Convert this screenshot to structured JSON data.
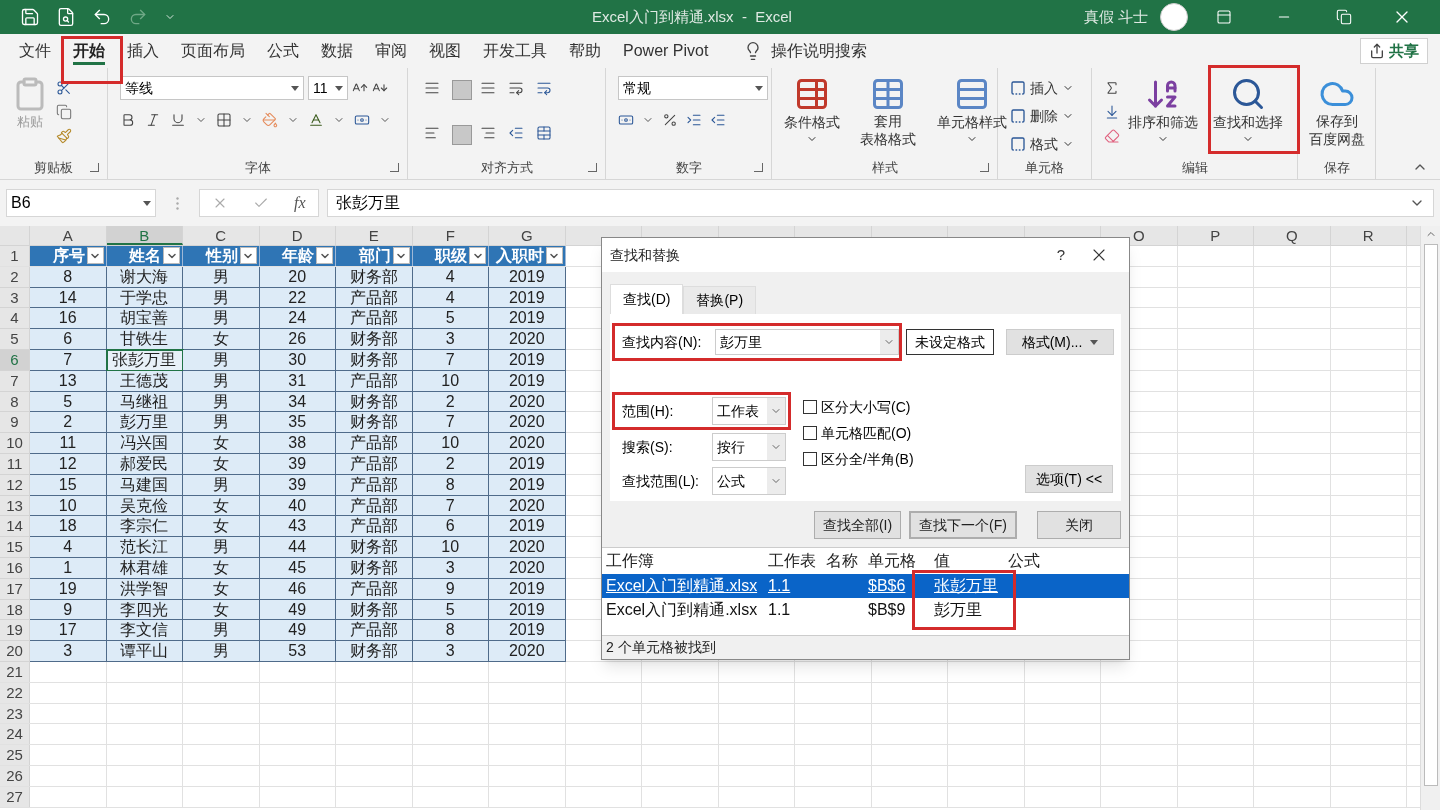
{
  "title_bar": {
    "title": "Excel入门到精通.xlsx  -  Excel",
    "user": "真假 斗士"
  },
  "ribbon_tabs": [
    {
      "label": "文件",
      "selected": false
    },
    {
      "label": "开始",
      "selected": true
    },
    {
      "label": "插入",
      "selected": false
    },
    {
      "label": "页面布局",
      "selected": false
    },
    {
      "label": "公式",
      "selected": false
    },
    {
      "label": "数据",
      "selected": false
    },
    {
      "label": "审阅",
      "selected": false
    },
    {
      "label": "视图",
      "selected": false
    },
    {
      "label": "开发工具",
      "selected": false
    },
    {
      "label": "帮助",
      "selected": false
    },
    {
      "label": "Power Pivot",
      "selected": false
    }
  ],
  "tell_me": "操作说明搜索",
  "share": "共享",
  "ribbon": {
    "clipboard": {
      "label": "剪贴板",
      "paste": "粘贴"
    },
    "font": {
      "label": "字体",
      "font_name": "等线",
      "font_size": "11"
    },
    "alignment": {
      "label": "对齐方式"
    },
    "number": {
      "label": "数字",
      "format": "常规"
    },
    "styles": {
      "label": "样式",
      "conditional": "条件格式",
      "table_format": [
        "套用",
        "表格格式"
      ],
      "cell_styles": "单元格样式"
    },
    "cells": {
      "label": "单元格",
      "items": [
        "插入",
        "删除",
        "格式"
      ]
    },
    "editing": {
      "label": "编辑",
      "sort": "排序和筛选",
      "find": "查找和选择"
    },
    "save": {
      "label": "保存",
      "button": [
        "保存到",
        "百度网盘"
      ]
    }
  },
  "formula_bar": {
    "name_box": "B6",
    "fx": "fx",
    "formula": "张彭万里"
  },
  "sheet": {
    "columns_left": [
      {
        "letter": "A",
        "selected": false
      },
      {
        "letter": "B",
        "selected": true
      },
      {
        "letter": "C",
        "selected": false
      },
      {
        "letter": "D",
        "selected": false
      },
      {
        "letter": "E",
        "selected": false
      },
      {
        "letter": "F",
        "selected": false
      },
      {
        "letter": "G",
        "selected": false
      }
    ],
    "columns_right": [
      "O",
      "P",
      "Q",
      "R"
    ],
    "header_row_number": "1",
    "header": [
      "序号",
      "姓名",
      "性别",
      "年龄",
      "部门",
      "职级",
      "入职时"
    ],
    "rows": [
      {
        "number": "2",
        "cells": [
          "8",
          "谢大海",
          "男",
          "20",
          "财务部",
          "4",
          "2019"
        ],
        "selected": false
      },
      {
        "number": "3",
        "cells": [
          "14",
          "于学忠",
          "男",
          "22",
          "产品部",
          "4",
          "2019"
        ],
        "selected": false
      },
      {
        "number": "4",
        "cells": [
          "16",
          "胡宝善",
          "男",
          "24",
          "产品部",
          "5",
          "2019"
        ],
        "selected": false
      },
      {
        "number": "5",
        "cells": [
          "6",
          "甘铁生",
          "女",
          "26",
          "财务部",
          "3",
          "2020"
        ],
        "selected": false
      },
      {
        "number": "6",
        "cells": [
          "7",
          "张彭万里",
          "男",
          "30",
          "财务部",
          "7",
          "2019"
        ],
        "selected": true
      },
      {
        "number": "7",
        "cells": [
          "13",
          "王德茂",
          "男",
          "31",
          "产品部",
          "10",
          "2019"
        ],
        "selected": false
      },
      {
        "number": "8",
        "cells": [
          "5",
          "马继祖",
          "男",
          "34",
          "财务部",
          "2",
          "2020"
        ],
        "selected": false
      },
      {
        "number": "9",
        "cells": [
          "2",
          "彭万里",
          "男",
          "35",
          "财务部",
          "7",
          "2020"
        ],
        "selected": false
      },
      {
        "number": "10",
        "cells": [
          "11",
          "冯兴国",
          "女",
          "38",
          "产品部",
          "10",
          "2020"
        ],
        "selected": false
      },
      {
        "number": "11",
        "cells": [
          "12",
          "郝爱民",
          "女",
          "39",
          "产品部",
          "2",
          "2019"
        ],
        "selected": false
      },
      {
        "number": "12",
        "cells": [
          "15",
          "马建国",
          "男",
          "39",
          "产品部",
          "8",
          "2019"
        ],
        "selected": false
      },
      {
        "number": "13",
        "cells": [
          "10",
          "吴克俭",
          "女",
          "40",
          "产品部",
          "7",
          "2020"
        ],
        "selected": false
      },
      {
        "number": "14",
        "cells": [
          "18",
          "李宗仁",
          "女",
          "43",
          "产品部",
          "6",
          "2019"
        ],
        "selected": false
      },
      {
        "number": "15",
        "cells": [
          "4",
          "范长江",
          "男",
          "44",
          "财务部",
          "10",
          "2020"
        ],
        "selected": false
      },
      {
        "number": "16",
        "cells": [
          "1",
          "林君雄",
          "女",
          "45",
          "财务部",
          "3",
          "2020"
        ],
        "selected": false
      },
      {
        "number": "17",
        "cells": [
          "19",
          "洪学智",
          "女",
          "46",
          "产品部",
          "9",
          "2019"
        ],
        "selected": false
      },
      {
        "number": "18",
        "cells": [
          "9",
          "李四光",
          "女",
          "49",
          "财务部",
          "5",
          "2019"
        ],
        "selected": false
      },
      {
        "number": "19",
        "cells": [
          "17",
          "李文信",
          "男",
          "49",
          "产品部",
          "8",
          "2019"
        ],
        "selected": false
      },
      {
        "number": "20",
        "cells": [
          "3",
          "谭平山",
          "男",
          "53",
          "财务部",
          "3",
          "2020"
        ],
        "selected": false
      }
    ],
    "empty_rows": [
      "21",
      "22",
      "23",
      "24",
      "25",
      "26",
      "27"
    ]
  },
  "dialog": {
    "title": "查找和替换",
    "help": "?",
    "tabs": [
      {
        "label": "查找(D)",
        "selected": true
      },
      {
        "label": "替换(P)",
        "selected": false
      }
    ],
    "find_label": "查找内容(N):",
    "find_value": "彭万里",
    "no_format": "未设定格式",
    "format_button": "格式(M)...",
    "options": [
      {
        "label": "范围(H):",
        "value": "工作表"
      },
      {
        "label": "搜索(S):",
        "value": "按行"
      },
      {
        "label": "查找范围(L):",
        "value": "公式"
      }
    ],
    "checkboxes": [
      {
        "label": "区分大小写(C)",
        "checked": false
      },
      {
        "label": "单元格匹配(O)",
        "checked": false
      },
      {
        "label": "区分全/半角(B)",
        "checked": false
      }
    ],
    "options_button": "选项(T) <<",
    "buttons": [
      {
        "label": "查找全部(I)",
        "default": false
      },
      {
        "label": "查找下一个(F)",
        "default": true
      },
      {
        "label": "关闭",
        "default": false
      }
    ],
    "result_columns": [
      "工作簿",
      "工作表",
      "名称",
      "单元格",
      "值",
      "公式"
    ],
    "results": [
      {
        "workbook": "Excel入门到精通.xlsx",
        "sheet": "1.1",
        "cell": "$B$6",
        "value": "张彭万里",
        "selected": true
      },
      {
        "workbook": "Excel入门到精通.xlsx",
        "sheet": "1.1",
        "cell": "$B$9",
        "value": "彭万里",
        "selected": false
      }
    ],
    "status": "2 个单元格被找到"
  }
}
